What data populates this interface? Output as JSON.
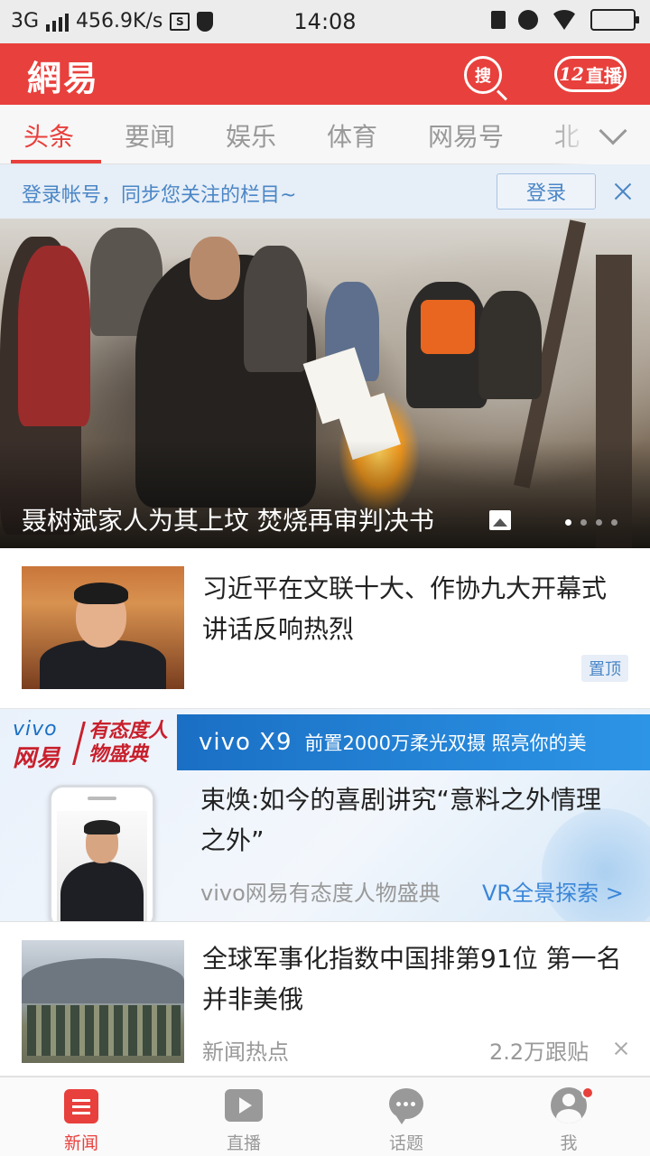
{
  "status_bar": {
    "network": "3G",
    "speed": "456.9K/s",
    "time": "14:08",
    "icons": [
      "signal-icon",
      "screenshot-icon",
      "shield-icon",
      "mute-icon",
      "alarm-icon",
      "wifi-icon",
      "battery-icon"
    ]
  },
  "header": {
    "logo": "網易",
    "search_label": "搜",
    "live_count": "12",
    "live_label": "直播"
  },
  "tabs": [
    {
      "label": "头条",
      "active": true
    },
    {
      "label": "要闻",
      "active": false
    },
    {
      "label": "娱乐",
      "active": false
    },
    {
      "label": "体育",
      "active": false
    },
    {
      "label": "网易号",
      "active": false
    },
    {
      "label": "北",
      "active": false
    }
  ],
  "login_bar": {
    "prompt": "登录帐号，同步您关注的栏目~",
    "button": "登录"
  },
  "hero": {
    "caption": "聂树斌家人为其上坟 焚烧再审判决书",
    "slide_count": 4,
    "active_slide": 1
  },
  "articles": [
    {
      "title": "习近平在文联十大、作协九大开幕式讲话反响热烈",
      "badge": "置顶"
    },
    {
      "title": "全球军事化指数中国排第91位 第一名并非美俄",
      "source": "新闻热点",
      "comments": "2.2万跟贴"
    }
  ],
  "ad": {
    "brand_vivo": "vivo",
    "brand_wangyi": "网易",
    "event_name": "有态度人物盛典",
    "model": "vivo X9",
    "slogan": "前置2000万柔光双摄 照亮你的美",
    "title": "束焕:如今的喜剧讲究“意料之外情理之外”",
    "source": "vivo网易有态度人物盛典",
    "cta": "VR全景探索 >"
  },
  "bottom_nav": [
    {
      "label": "新闻",
      "active": true
    },
    {
      "label": "直播",
      "active": false
    },
    {
      "label": "话题",
      "active": false
    },
    {
      "label": "我",
      "active": false,
      "badge_dot": true
    }
  ],
  "colors": {
    "brand_red": "#e8403c",
    "link_blue": "#4a86c6",
    "ad_blue": "#1a6fc4"
  }
}
